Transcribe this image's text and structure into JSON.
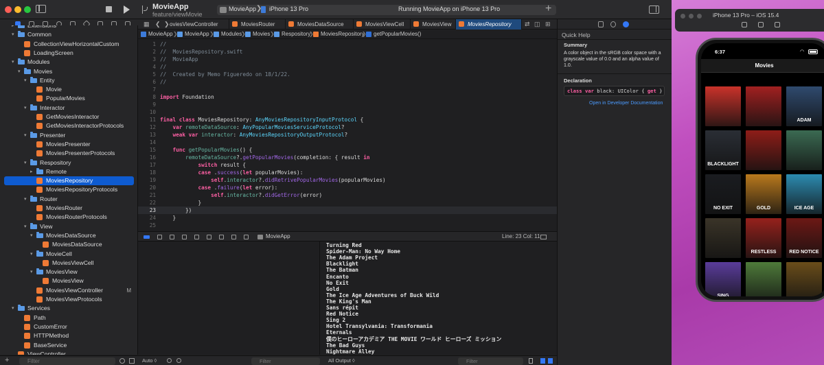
{
  "window": {
    "app_title": "MovieApp",
    "branch": "feature/viewMovie",
    "scheme_app": "MovieApp",
    "scheme_device": "iPhone 13 Pro",
    "run_status": "Running MovieApp on iPhone 13 Pro"
  },
  "navigator": {
    "rows": [
      {
        "label": "Extensions",
        "type": "folder",
        "level": 1,
        "open": false
      },
      {
        "label": "Common",
        "type": "folder",
        "level": 1,
        "open": true
      },
      {
        "label": "CollectionViewHorizontalCustom",
        "type": "swift",
        "level": 2
      },
      {
        "label": "LoadingScreen",
        "type": "swift",
        "level": 2
      },
      {
        "label": "Modules",
        "type": "folder",
        "level": 1,
        "open": true
      },
      {
        "label": "Movies",
        "type": "folder",
        "level": 2,
        "open": true
      },
      {
        "label": "Entity",
        "type": "folder",
        "level": 3,
        "open": true
      },
      {
        "label": "Movie",
        "type": "swift",
        "level": 4
      },
      {
        "label": "PopularMovies",
        "type": "swift",
        "level": 4
      },
      {
        "label": "Interactor",
        "type": "folder",
        "level": 3,
        "open": true
      },
      {
        "label": "GetMoviesInteractor",
        "type": "swift",
        "level": 4
      },
      {
        "label": "GetMoviesInteractorProtocols",
        "type": "swift",
        "level": 4
      },
      {
        "label": "Presenter",
        "type": "folder",
        "level": 3,
        "open": true
      },
      {
        "label": "MoviesPresenter",
        "type": "swift",
        "level": 4
      },
      {
        "label": "MoviesPresenterProtocols",
        "type": "swift",
        "level": 4
      },
      {
        "label": "Respository",
        "type": "folder",
        "level": 3,
        "open": true
      },
      {
        "label": "Remote",
        "type": "folder",
        "level": 4,
        "open": false
      },
      {
        "label": "MoviesRepository",
        "type": "swift",
        "level": 4,
        "selected": true
      },
      {
        "label": "MoviesRepositoryProtocols",
        "type": "swift",
        "level": 4
      },
      {
        "label": "Router",
        "type": "folder",
        "level": 3,
        "open": true
      },
      {
        "label": "MoviesRouter",
        "type": "swift",
        "level": 4
      },
      {
        "label": "MoviesRouterProtocols",
        "type": "swift",
        "level": 4
      },
      {
        "label": "View",
        "type": "folder",
        "level": 3,
        "open": true
      },
      {
        "label": "MoviesDataSource",
        "type": "folder",
        "level": 4,
        "open": true
      },
      {
        "label": "MoviesDataSource",
        "type": "swift",
        "level": 5
      },
      {
        "label": "MovieCell",
        "type": "folder",
        "level": 4,
        "open": true
      },
      {
        "label": "MoviesViewCell",
        "type": "swift",
        "level": 5
      },
      {
        "label": "MoviesView",
        "type": "folder",
        "level": 4,
        "open": true
      },
      {
        "label": "MoviesView",
        "type": "swift",
        "level": 5
      },
      {
        "label": "MoviesViewController",
        "type": "swift",
        "level": 4,
        "badge": "M"
      },
      {
        "label": "MoviesViewProtocols",
        "type": "swift",
        "level": 4
      },
      {
        "label": "Services",
        "type": "folder",
        "level": 1,
        "open": true
      },
      {
        "label": "Path",
        "type": "swift",
        "level": 2
      },
      {
        "label": "CustomError",
        "type": "swift",
        "level": 2
      },
      {
        "label": "HTTPMethod",
        "type": "swift",
        "level": 2
      },
      {
        "label": "BaseService",
        "type": "swift",
        "level": 2
      },
      {
        "label": "ViewController",
        "type": "swift",
        "level": 1
      }
    ],
    "filter_placeholder": "Filter"
  },
  "tabs": [
    {
      "label": "oviesViewController"
    },
    {
      "label": "MoviesRouter"
    },
    {
      "label": "MoviesDataSource"
    },
    {
      "label": "MoviesViewCell"
    },
    {
      "label": "MoviesView"
    },
    {
      "label": "MoviesRepository",
      "active": true
    }
  ],
  "jumpbar": [
    "MovieApp",
    "MovieApp",
    "Modules",
    "Movies",
    "Respository",
    "MoviesRepository",
    "getPopularMovies()"
  ],
  "code": [
    {
      "n": "1",
      "t": [
        [
          "//",
          "c-comment"
        ]
      ]
    },
    {
      "n": "2",
      "t": [
        [
          "//  MoviesRepository.swift",
          "c-comment"
        ]
      ]
    },
    {
      "n": "3",
      "t": [
        [
          "//  MovieApp",
          "c-comment"
        ]
      ]
    },
    {
      "n": "4",
      "t": [
        [
          "//",
          "c-comment"
        ]
      ]
    },
    {
      "n": "5",
      "t": [
        [
          "//  Created by Memo Figueredo on 18/1/22.",
          "c-comment"
        ]
      ]
    },
    {
      "n": "6",
      "t": [
        [
          "//",
          "c-comment"
        ]
      ]
    },
    {
      "n": "7",
      "t": []
    },
    {
      "n": "8",
      "t": [
        [
          "import",
          "c-kw"
        ],
        [
          " Foundation",
          "c-norm"
        ]
      ]
    },
    {
      "n": "9",
      "t": []
    },
    {
      "n": "10",
      "t": []
    },
    {
      "n": "11",
      "t": [
        [
          "final class",
          "c-kw"
        ],
        [
          " MoviesRepository: ",
          "c-norm"
        ],
        [
          "AnyMoviesRepositoryInputProtocol",
          "c-type"
        ],
        [
          " {",
          "c-norm"
        ]
      ]
    },
    {
      "n": "12",
      "t": [
        [
          "    ",
          "c-ws"
        ],
        [
          "var",
          "c-kw"
        ],
        [
          " remoteDataSource",
          "c-call"
        ],
        [
          ": ",
          "c-norm"
        ],
        [
          "AnyPopularMoviesServiceProtocol",
          "c-type"
        ],
        [
          "?",
          "c-norm"
        ]
      ]
    },
    {
      "n": "13",
      "t": [
        [
          "    ",
          "c-ws"
        ],
        [
          "weak var",
          "c-kw"
        ],
        [
          " interactor",
          "c-call"
        ],
        [
          ": ",
          "c-norm"
        ],
        [
          "AnyMoviesRepositoryOutputProtocol",
          "c-type"
        ],
        [
          "?",
          "c-norm"
        ]
      ]
    },
    {
      "n": "14",
      "t": []
    },
    {
      "n": "15",
      "t": [
        [
          "    ",
          "c-ws"
        ],
        [
          "func",
          "c-kw"
        ],
        [
          " getPopularMovies",
          "c-call"
        ],
        [
          "() {",
          "c-norm"
        ]
      ]
    },
    {
      "n": "16",
      "t": [
        [
          "        ",
          "c-ws"
        ],
        [
          "remoteDataSource",
          "c-call"
        ],
        [
          "?.",
          "c-norm"
        ],
        [
          "getPopularMovies",
          "c-prop"
        ],
        [
          "(completion: { result ",
          "c-norm"
        ],
        [
          "in",
          "c-kw"
        ]
      ]
    },
    {
      "n": "17",
      "t": [
        [
          "            ",
          "c-ws"
        ],
        [
          "switch",
          "c-kw"
        ],
        [
          " result {",
          "c-norm"
        ]
      ]
    },
    {
      "n": "18",
      "t": [
        [
          "            ",
          "c-ws"
        ],
        [
          "case",
          "c-kw"
        ],
        [
          " .",
          "c-norm"
        ],
        [
          "success",
          "c-prop"
        ],
        [
          "(",
          "c-norm"
        ],
        [
          "let",
          "c-kw"
        ],
        [
          " popularMovies):",
          "c-norm"
        ]
      ]
    },
    {
      "n": "19",
      "t": [
        [
          "                ",
          "c-ws"
        ],
        [
          "self",
          "c-kw"
        ],
        [
          ".",
          "c-norm"
        ],
        [
          "interactor",
          "c-call"
        ],
        [
          "?.",
          "c-norm"
        ],
        [
          "didRetrivePopularMovies",
          "c-prop"
        ],
        [
          "(popularMovies)",
          "c-norm"
        ]
      ]
    },
    {
      "n": "20",
      "t": [
        [
          "            ",
          "c-ws"
        ],
        [
          "case",
          "c-kw"
        ],
        [
          " .",
          "c-norm"
        ],
        [
          "failure",
          "c-prop"
        ],
        [
          "(",
          "c-norm"
        ],
        [
          "let",
          "c-kw"
        ],
        [
          " error):",
          "c-norm"
        ]
      ]
    },
    {
      "n": "21",
      "t": [
        [
          "                ",
          "c-ws"
        ],
        [
          "self",
          "c-kw"
        ],
        [
          ".",
          "c-norm"
        ],
        [
          "interactor",
          "c-call"
        ],
        [
          "?.",
          "c-norm"
        ],
        [
          "didGetError",
          "c-prop"
        ],
        [
          "(error)",
          "c-norm"
        ]
      ]
    },
    {
      "n": "22",
      "t": [
        [
          "            ",
          "c-ws"
        ],
        [
          "}",
          "c-norm"
        ]
      ]
    },
    {
      "n": "23",
      "t": [
        [
          "        ",
          "c-ws"
        ],
        [
          "})",
          "c-norm"
        ]
      ],
      "current": true
    },
    {
      "n": "24",
      "t": [
        [
          "    ",
          "c-ws"
        ],
        [
          "}",
          "c-norm"
        ]
      ]
    },
    {
      "n": "25",
      "t": []
    },
    {
      "n": "26",
      "t": []
    },
    {
      "n": "27",
      "t": [
        [
          "}",
          "c-norm"
        ]
      ]
    }
  ],
  "debug": {
    "target": "MovieApp",
    "line_col": "Line: 23  Col: 11"
  },
  "console_lines": [
    "Turning Red",
    "Spider-Man: No Way Home",
    "The Adam Project",
    "Blacklight",
    "The Batman",
    "Encanto",
    "No Exit",
    "Gold",
    "The Ice Age Adventures of Buck Wild",
    "The King's Man",
    "Sans répit",
    "Red Notice",
    "Sing 2",
    "Hotel Transylvania: Transformania",
    "Eternals",
    "僕のヒーローアカデミア THE MOVIE ワールド ヒーローズ ミッション",
    "The Bad Guys",
    "Nightmare Alley"
  ],
  "bottom": {
    "auto": "Auto ◊",
    "filter_placeholder": "Filter",
    "output": "All Output ◊",
    "filter2_placeholder": "Filter"
  },
  "inspector": {
    "title": "Quick Help",
    "summary_heading": "Summary",
    "summary": "A color object in the sRGB color space with a grayscale value of 0.0 and an alpha value of 1.0.",
    "declaration_heading": "Declaration",
    "decl_kw": "class var",
    "decl_rest": " black: UIColor { ",
    "decl_get": "get",
    "decl_end": " }",
    "link": "Open in Developer Documentation"
  },
  "simulator": {
    "title": "iPhone 13 Pro – iOS 15.4",
    "time": "6:37",
    "screen_title": "Movies",
    "posters": [
      {
        "label": "",
        "color": "#c9322a"
      },
      {
        "label": "",
        "color": "#a12020"
      },
      {
        "label": "ADAM",
        "color": "#2f4a6e"
      },
      {
        "label": "BLACKLIGHT",
        "color": "#2a2e35"
      },
      {
        "label": "",
        "color": "#8e1d18"
      },
      {
        "label": "",
        "color": "#3b6a52"
      },
      {
        "label": "NO EXIT",
        "color": "#1a1c20"
      },
      {
        "label": "GOLD",
        "color": "#b9791d"
      },
      {
        "label": "ICE AGE",
        "color": "#2c8bb0"
      },
      {
        "label": "",
        "color": "#3a3428"
      },
      {
        "label": "RESTLESS",
        "color": "#96211c"
      },
      {
        "label": "RED NOTICE",
        "color": "#6c1815"
      },
      {
        "label": "SING",
        "color": "#5a3c9a"
      },
      {
        "label": "",
        "color": "#4e7a3a"
      },
      {
        "label": "",
        "color": "#6a4d1a"
      }
    ]
  }
}
